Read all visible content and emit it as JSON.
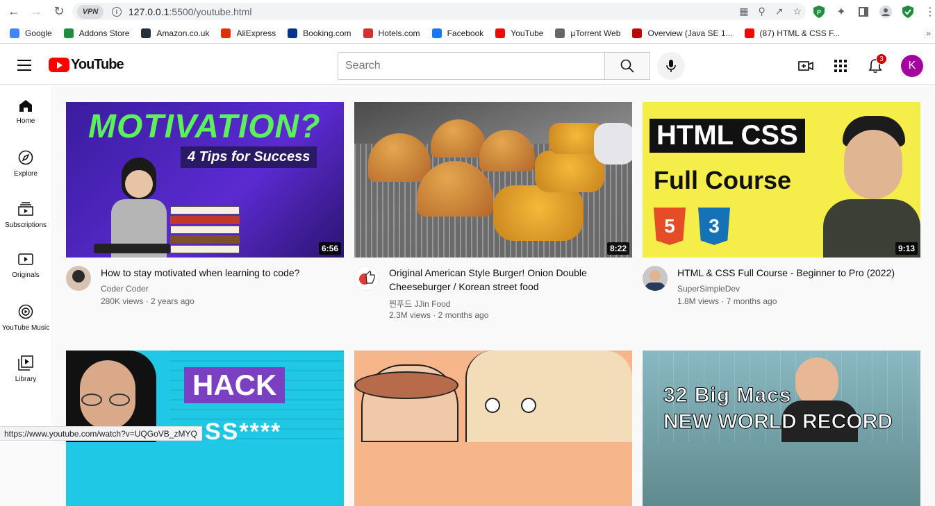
{
  "browser": {
    "vpn_label": "VPN",
    "url_host": "127.0.0.1",
    "url_rest": ":5500/youtube.html",
    "bookmarks": [
      {
        "label": "Google",
        "color": "#4285f4"
      },
      {
        "label": "Addons Store",
        "color": "#1e8e3e"
      },
      {
        "label": "Amazon.co.uk",
        "color": "#232f3e"
      },
      {
        "label": "AliExpress",
        "color": "#e62e04"
      },
      {
        "label": "Booking.com",
        "color": "#003580"
      },
      {
        "label": "Hotels.com",
        "color": "#d32f2f"
      },
      {
        "label": "Facebook",
        "color": "#1877f2"
      },
      {
        "label": "YouTube",
        "color": "#ff0000"
      },
      {
        "label": "µTorrent Web",
        "color": "#666666"
      },
      {
        "label": "Overview (Java SE 1...",
        "color": "#c00000"
      },
      {
        "label": "(87) HTML & CSS F...",
        "color": "#ff0000"
      }
    ],
    "more": "»",
    "status_url": "https://www.youtube.com/watch?v=UQGoVB_zMYQ"
  },
  "header": {
    "logo_text": "YouTube",
    "search_placeholder": "Search",
    "notification_count": "3",
    "avatar_letter": "K",
    "avatar_color": "#a4009f"
  },
  "sidebar": {
    "items": [
      {
        "label": "Home",
        "icon": "home-icon"
      },
      {
        "label": "Explore",
        "icon": "compass-icon"
      },
      {
        "label": "Subscriptions",
        "icon": "subscriptions-icon"
      },
      {
        "label": "Originals",
        "icon": "originals-icon"
      },
      {
        "label": "YouTube Music",
        "icon": "music-icon"
      },
      {
        "label": "Library",
        "icon": "library-icon"
      }
    ]
  },
  "videos": [
    {
      "title": "How to stay motivated when learning to code?",
      "channel": "Coder Coder",
      "stats": "280K views · 2 years ago",
      "duration": "6:56",
      "thumb_text_1": "MOTIVATION?",
      "thumb_text_2": "4 Tips for Success"
    },
    {
      "title": "Original American Style Burger! Onion Double Cheeseburger / Korean street food",
      "channel": "찐푸드 JJin Food",
      "stats": "2.3M views · 2 months ago",
      "duration": "8:22"
    },
    {
      "title": "HTML & CSS Full Course - Beginner to Pro (2022)",
      "channel": "SuperSimpleDev",
      "stats": "1.8M views · 7 months ago",
      "duration": "9:13",
      "thumb_text_1": "HTML CSS",
      "thumb_text_2": "Full Course"
    },
    {
      "thumb_text_1": "HACK",
      "thumb_text_2": "SS****"
    },
    {},
    {
      "thumb_text_1": "32 Big Macs",
      "thumb_text_2": "NEW WORLD RECORD"
    }
  ]
}
